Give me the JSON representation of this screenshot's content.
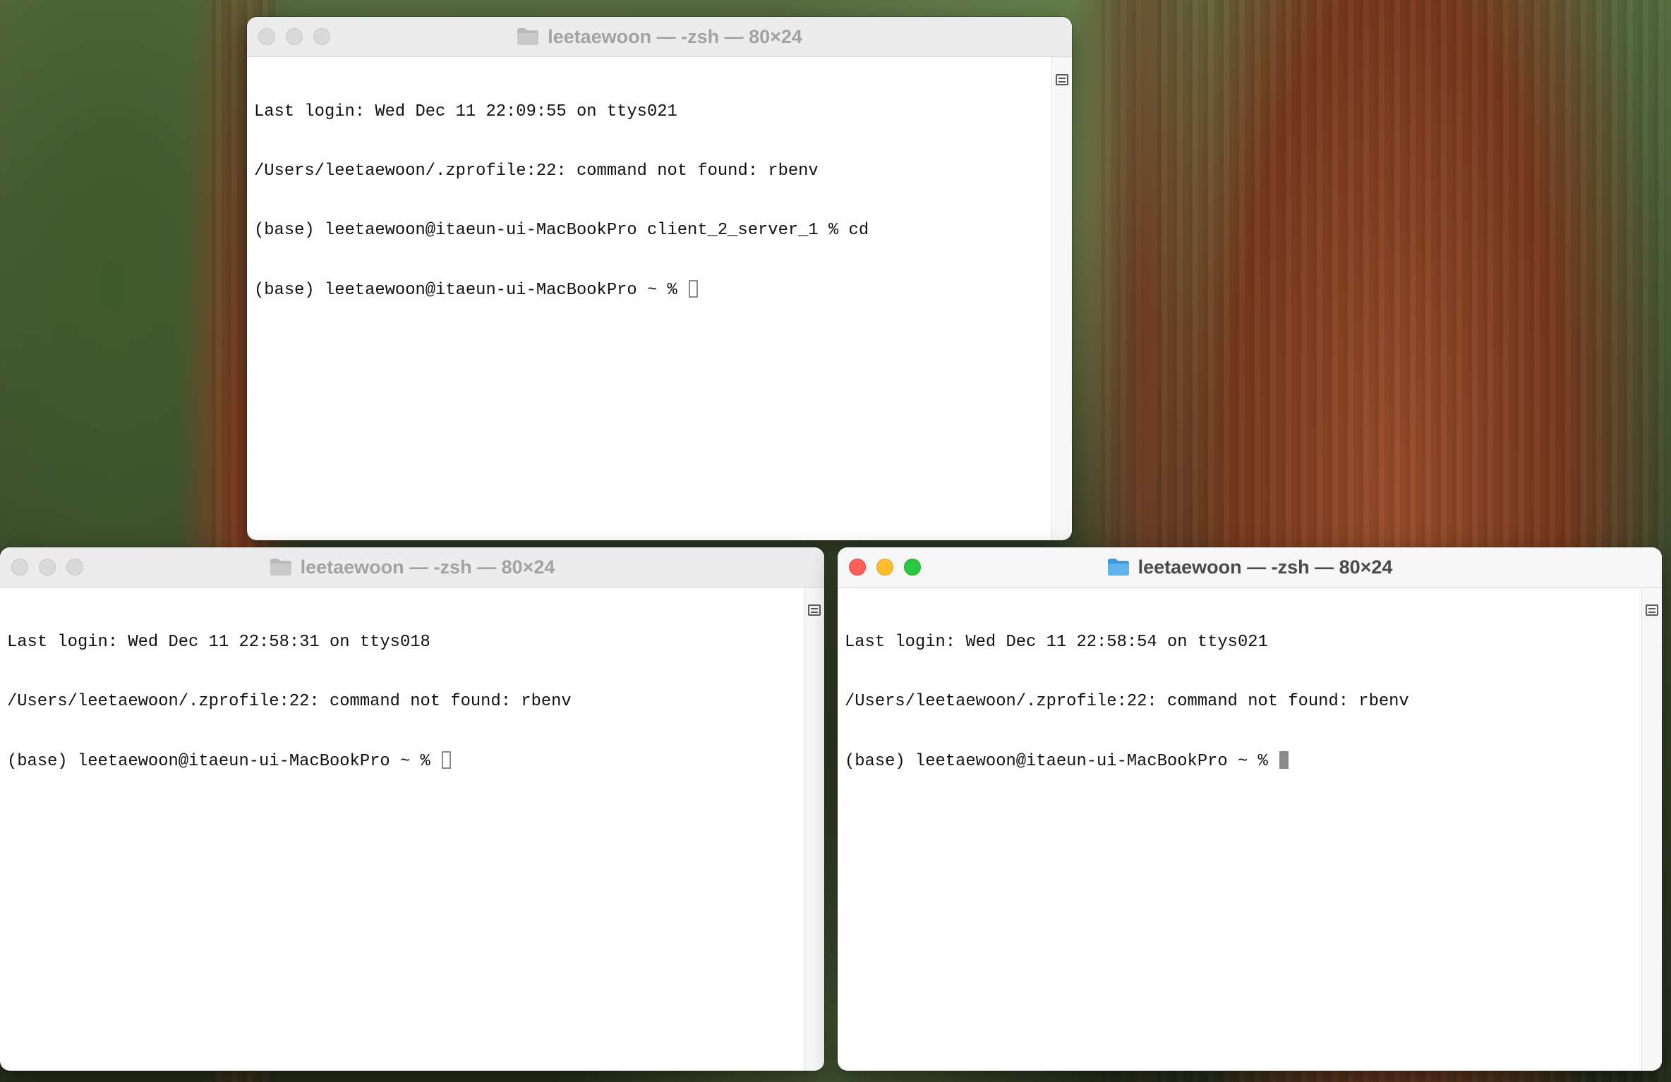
{
  "windows": [
    {
      "title": "leetaewoon — -zsh — 80×24",
      "active": false,
      "lines": [
        "Last login: Wed Dec 11 22:09:55 on ttys021",
        "/Users/leetaewoon/.zprofile:22: command not found: rbenv",
        "(base) leetaewoon@itaeun-ui-MacBookPro client_2_server_1 % cd",
        "(base) leetaewoon@itaeun-ui-MacBookPro ~ % "
      ]
    },
    {
      "title": "leetaewoon — -zsh — 80×24",
      "active": false,
      "lines": [
        "Last login: Wed Dec 11 22:58:31 on ttys018",
        "/Users/leetaewoon/.zprofile:22: command not found: rbenv",
        "(base) leetaewoon@itaeun-ui-MacBookPro ~ % "
      ]
    },
    {
      "title": "leetaewoon — -zsh — 80×24",
      "active": true,
      "lines": [
        "Last login: Wed Dec 11 22:58:54 on ttys021",
        "/Users/leetaewoon/.zprofile:22: command not found: rbenv",
        "(base) leetaewoon@itaeun-ui-MacBookPro ~ % "
      ]
    }
  ],
  "icons": {
    "title_icon": "folder-icon",
    "scroll_icon": "scroll-view-icon"
  },
  "colors": {
    "close": "#ff5f57",
    "minimize": "#febc2e",
    "maximize": "#28c840",
    "folder_active": "#5fb3ea",
    "folder_inactive": "#b9b9b9"
  }
}
